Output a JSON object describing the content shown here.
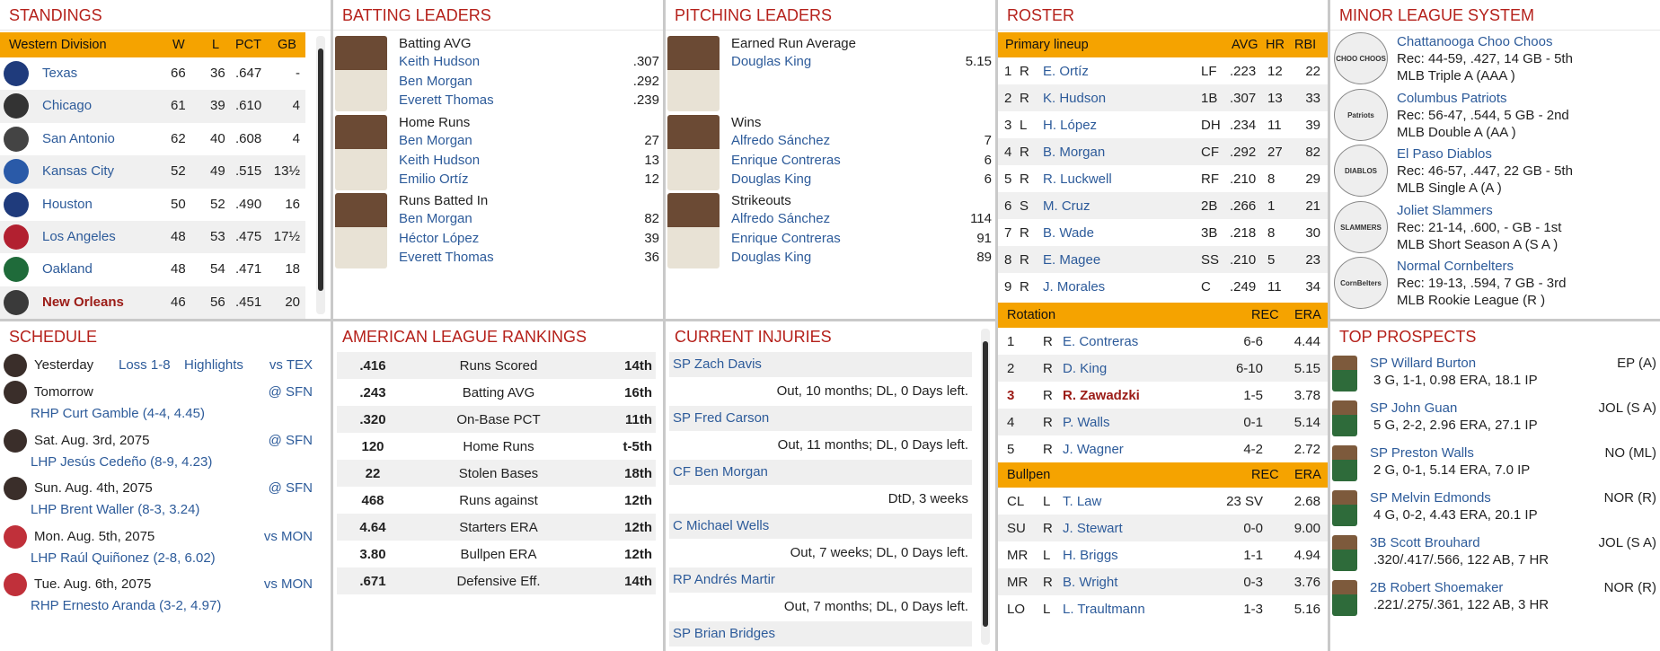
{
  "standings": {
    "title": "STANDINGS",
    "division": "Western Division",
    "cols": [
      "W",
      "L",
      "PCT",
      "GB"
    ],
    "teams": [
      {
        "name": "Texas",
        "w": "66",
        "l": "36",
        "pct": ".647",
        "gb": "-",
        "color": "#1f3b7c"
      },
      {
        "name": "Chicago",
        "w": "61",
        "l": "39",
        "pct": ".610",
        "gb": "4",
        "color": "#333"
      },
      {
        "name": "San Antonio",
        "w": "62",
        "l": "40",
        "pct": ".608",
        "gb": "4",
        "color": "#444"
      },
      {
        "name": "Kansas City",
        "w": "52",
        "l": "49",
        "pct": ".515",
        "gb": "13½",
        "color": "#2a5aa8"
      },
      {
        "name": "Houston",
        "w": "50",
        "l": "52",
        "pct": ".490",
        "gb": "16",
        "color": "#1f3b7c"
      },
      {
        "name": "Los Angeles",
        "w": "48",
        "l": "53",
        "pct": ".475",
        "gb": "17½",
        "color": "#b22030"
      },
      {
        "name": "Oakland",
        "w": "48",
        "l": "54",
        "pct": ".471",
        "gb": "18",
        "color": "#1f6b3a"
      },
      {
        "name": "New Orleans",
        "w": "46",
        "l": "56",
        "pct": ".451",
        "gb": "20",
        "color": "#3a3a3a"
      }
    ]
  },
  "batting": {
    "title": "BATTING LEADERS",
    "groups": [
      {
        "cat": "Batting AVG",
        "rows": [
          [
            "Keith Hudson",
            ".307"
          ],
          [
            "Ben Morgan",
            ".292"
          ],
          [
            "Everett Thomas",
            ".239"
          ]
        ]
      },
      {
        "cat": "Home Runs",
        "rows": [
          [
            "Ben Morgan",
            "27"
          ],
          [
            "Keith Hudson",
            "13"
          ],
          [
            "Emilio Ortíz",
            "12"
          ]
        ]
      },
      {
        "cat": "Runs Batted In",
        "rows": [
          [
            "Ben Morgan",
            "82"
          ],
          [
            "Héctor López",
            "39"
          ],
          [
            "Everett Thomas",
            "36"
          ]
        ]
      }
    ]
  },
  "pitching": {
    "title": "PITCHING LEADERS",
    "groups": [
      {
        "cat": "Earned Run Average",
        "rows": [
          [
            "Douglas King",
            "5.15"
          ]
        ]
      },
      {
        "cat": "Wins",
        "rows": [
          [
            "Alfredo Sánchez",
            "7"
          ],
          [
            "Enrique Contreras",
            "6"
          ],
          [
            "Douglas King",
            "6"
          ]
        ]
      },
      {
        "cat": "Strikeouts",
        "rows": [
          [
            "Alfredo Sánchez",
            "114"
          ],
          [
            "Enrique Contreras",
            "91"
          ],
          [
            "Douglas King",
            "89"
          ]
        ]
      }
    ]
  },
  "roster": {
    "title": "ROSTER",
    "lineup_title": "Primary lineup",
    "lineup_cols": [
      "AVG",
      "HR",
      "RBI"
    ],
    "lineup": [
      [
        "1",
        "R",
        "E. Ortíz",
        "LF",
        ".223",
        "12",
        "22"
      ],
      [
        "2",
        "R",
        "K. Hudson",
        "1B",
        ".307",
        "13",
        "33"
      ],
      [
        "3",
        "L",
        "H. López",
        "DH",
        ".234",
        "11",
        "39"
      ],
      [
        "4",
        "R",
        "B. Morgan",
        "CF",
        ".292",
        "27",
        "82"
      ],
      [
        "5",
        "R",
        "R. Luckwell",
        "RF",
        ".210",
        "8",
        "29"
      ],
      [
        "6",
        "S",
        "M. Cruz",
        "2B",
        ".266",
        "1",
        "21"
      ],
      [
        "7",
        "R",
        "B. Wade",
        "3B",
        ".218",
        "8",
        "30"
      ],
      [
        "8",
        "R",
        "E. Magee",
        "SS",
        ".210",
        "5",
        "23"
      ],
      [
        "9",
        "R",
        "J. Morales",
        "C",
        ".249",
        "11",
        "34"
      ]
    ],
    "rot_title": "Rotation",
    "rot_cols": [
      "REC",
      "ERA"
    ],
    "rotation": [
      [
        "1",
        "R",
        "E. Contreras",
        "6-6",
        "4.44"
      ],
      [
        "2",
        "R",
        "D. King",
        "6-10",
        "5.15"
      ],
      [
        "3",
        "R",
        "R. Zawadzki",
        "1-5",
        "3.78"
      ],
      [
        "4",
        "R",
        "P. Walls",
        "0-1",
        "5.14"
      ],
      [
        "5",
        "R",
        "J. Wagner",
        "4-2",
        "2.72"
      ]
    ],
    "pen_title": "Bullpen",
    "pen_cols": [
      "REC",
      "ERA"
    ],
    "bullpen": [
      [
        "CL",
        "L",
        "T. Law",
        "23 SV",
        "2.68"
      ],
      [
        "SU",
        "R",
        "J. Stewart",
        "0-0",
        "9.00"
      ],
      [
        "MR",
        "L",
        "H. Briggs",
        "1-1",
        "4.94"
      ],
      [
        "MR",
        "R",
        "B. Wright",
        "0-3",
        "3.76"
      ],
      [
        "LO",
        "L",
        "L. Traultmann",
        "1-3",
        "5.16"
      ]
    ]
  },
  "minors": {
    "title": "MINOR LEAGUE SYSTEM",
    "teams": [
      {
        "name": "Chattanooga Choo Choos",
        "rec": "Rec: 44-59, .427, 14 GB - 5th",
        "lvl": "MLB Triple A (AAA )",
        "logo": "CHOO CHOOS"
      },
      {
        "name": "Columbus Patriots",
        "rec": "Rec: 56-47, .544, 5 GB - 2nd",
        "lvl": "MLB Double A (AA )",
        "logo": "Patriots"
      },
      {
        "name": "El Paso Diablos",
        "rec": "Rec: 46-57, .447, 22 GB - 5th",
        "lvl": "MLB Single A (A )",
        "logo": "DIABLOS"
      },
      {
        "name": "Joliet Slammers",
        "rec": "Rec: 21-14, .600, - GB - 1st",
        "lvl": "MLB Short Season A (S A )",
        "logo": "SLAMMERS"
      },
      {
        "name": "Normal Cornbelters",
        "rec": "Rec: 19-13, .594, 7 GB - 3rd",
        "lvl": "MLB Rookie League (R )",
        "logo": "CornBelters"
      }
    ]
  },
  "schedule": {
    "title": "SCHEDULE",
    "items": [
      {
        "day": "Yesterday",
        "result": "Loss 1-8",
        "hl": "Highlights",
        "opp": "vs TEX",
        "pitcher": ""
      },
      {
        "day": "Tomorrow",
        "result": "",
        "hl": "",
        "opp": "@ SFN",
        "pitcher": "RHP Curt Gamble (4-4, 4.45)"
      },
      {
        "day": "Sat. Aug. 3rd, 2075",
        "result": "",
        "hl": "",
        "opp": "@ SFN",
        "pitcher": "LHP Jesús Cedeño (8-9, 4.23)"
      },
      {
        "day": "Sun. Aug. 4th, 2075",
        "result": "",
        "hl": "",
        "opp": "@ SFN",
        "pitcher": "LHP Brent Waller (8-3, 3.24)"
      },
      {
        "day": "Mon. Aug. 5th, 2075",
        "result": "",
        "hl": "",
        "opp": "vs MON",
        "pitcher": "LHP Raúl Quiñonez (2-8, 6.02)"
      },
      {
        "day": "Tue. Aug. 6th, 2075",
        "result": "",
        "hl": "",
        "opp": "vs MON",
        "pitcher": "RHP Ernesto Aranda (3-2, 4.97)"
      }
    ]
  },
  "rankings": {
    "title": "AMERICAN LEAGUE RANKINGS",
    "rows": [
      [
        ".416",
        "Runs Scored",
        "14th"
      ],
      [
        ".243",
        "Batting AVG",
        "16th"
      ],
      [
        ".320",
        "On-Base PCT",
        "11th"
      ],
      [
        "120",
        "Home Runs",
        "t-5th"
      ],
      [
        "22",
        "Stolen Bases",
        "18th"
      ],
      [
        "468",
        "Runs against",
        "12th"
      ],
      [
        "4.64",
        "Starters ERA",
        "12th"
      ],
      [
        "3.80",
        "Bullpen ERA",
        "12th"
      ],
      [
        ".671",
        "Defensive Eff.",
        "14th"
      ]
    ]
  },
  "injuries": {
    "title": "CURRENT INJURIES",
    "items": [
      {
        "name": "SP Zach Davis",
        "status": "Out, 10 months; DL, 0 Days left."
      },
      {
        "name": "SP Fred Carson",
        "status": "Out, 11 months; DL, 0 Days left."
      },
      {
        "name": "CF Ben Morgan",
        "status": "DtD, 3 weeks"
      },
      {
        "name": "C Michael Wells",
        "status": "Out, 7 weeks; DL, 0 Days left."
      },
      {
        "name": "RP Andrés Martir",
        "status": "Out, 7 months; DL, 0 Days left."
      },
      {
        "name": "SP Brian Bridges",
        "status": ""
      }
    ]
  },
  "prospects": {
    "title": "TOP PROSPECTS",
    "items": [
      {
        "name": "SP Willard Burton",
        "team": "EP (A)",
        "line": "3 G, 1-1, 0.98 ERA, 18.1 IP"
      },
      {
        "name": "SP John Guan",
        "team": "JOL (S A)",
        "line": "5 G, 2-2, 2.96 ERA, 27.1 IP"
      },
      {
        "name": "SP Preston Walls",
        "team": "NO (ML)",
        "line": "2 G, 0-1, 5.14 ERA, 7.0 IP"
      },
      {
        "name": "SP Melvin Edmonds",
        "team": "NOR (R)",
        "line": "4 G, 0-2, 4.43 ERA, 20.1 IP"
      },
      {
        "name": "3B Scott Brouhard",
        "team": "JOL (S A)",
        "line": ".320/.417/.566, 122 AB, 7 HR"
      },
      {
        "name": "2B Robert Shoemaker",
        "team": "NOR (R)",
        "line": ".221/.275/.361, 122 AB, 3 HR"
      }
    ]
  }
}
